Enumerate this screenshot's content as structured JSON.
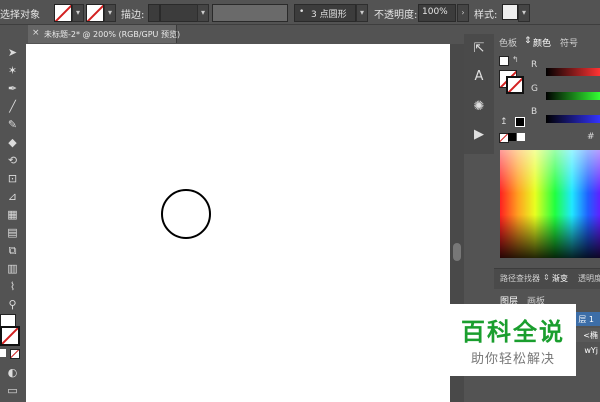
{
  "control_bar": {
    "selection_label": "选择对象",
    "stroke_label": "描边:",
    "brush_label": "3 点圆形",
    "opacity_label": "不透明度:",
    "opacity_value": "100%",
    "style_label": "样式:"
  },
  "document_tab": {
    "close_glyph": "×",
    "title": "未标题-2* @ 200% (RGB/GPU 预览)"
  },
  "color_panel": {
    "tabs": [
      "色板",
      "颜色",
      "符号"
    ],
    "channel_r": "R",
    "channel_g": "G",
    "channel_b": "B",
    "hash": "#"
  },
  "gradient_panel": {
    "tabs": [
      "路径查找器",
      "渐变",
      "透明度"
    ]
  },
  "layers_panel": {
    "tabs": [
      "图层",
      "画板"
    ],
    "layer_name": "层 1",
    "item_1": "<椭",
    "item_2": "wYj"
  },
  "watermark": {
    "main": "百科全说",
    "sub": "助你轻松解决"
  },
  "colors": {
    "ui_bg": "#535353",
    "canvas": "#ffffff",
    "watermark_green": "#1a9e2e"
  }
}
